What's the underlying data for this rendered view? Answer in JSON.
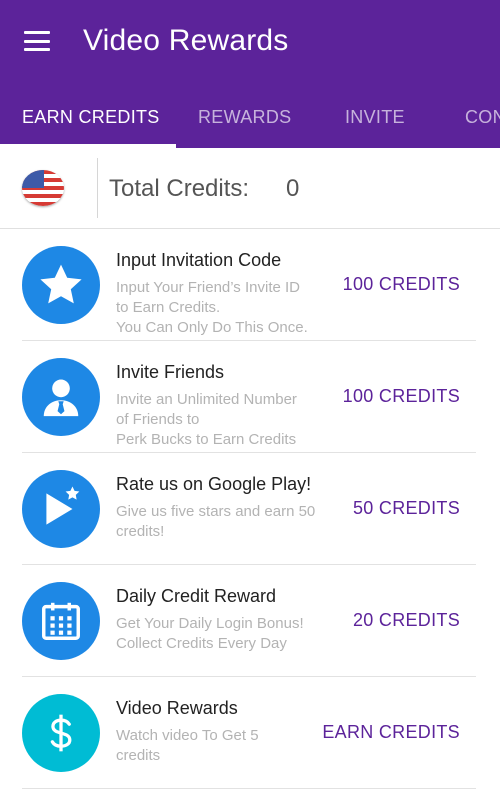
{
  "colors": {
    "primary": "#5c239a",
    "accent_blue": "#1e88e5",
    "accent_cyan": "#00bcd4",
    "action_text": "#5c239a"
  },
  "app": {
    "title": "Video Rewards",
    "menu_icon": "hamburger-menu-icon"
  },
  "tabs": [
    {
      "label": "EARN CREDITS",
      "active": true
    },
    {
      "label": "REWARDS",
      "active": false
    },
    {
      "label": "INVITE",
      "active": false
    },
    {
      "label": "CON",
      "active": false
    }
  ],
  "credits": {
    "flag_icon": "us-flag-icon",
    "label": "Total Credits:",
    "value": "0"
  },
  "offers": [
    {
      "icon": "star-icon",
      "title": "Input Invitation Code",
      "desc_lines": [
        "Input Your Friend’s Invite ID",
        "to Earn Credits.",
        "You Can Only Do This Once."
      ],
      "action": "100 CREDITS"
    },
    {
      "icon": "person-icon",
      "title": "Invite Friends",
      "desc_lines": [
        "Invite an Unlimited Number",
        "of Friends to",
        "Perk Bucks to Earn Credits"
      ],
      "action": "100 CREDITS"
    },
    {
      "icon": "play-star-icon",
      "title": "Rate us on Google Play!",
      "desc_lines": [
        "Give us five stars and earn 50",
        "credits!"
      ],
      "action": "50 CREDITS"
    },
    {
      "icon": "calendar-icon",
      "title": "Daily Credit Reward",
      "desc_lines": [
        "Get Your Daily Login Bonus!",
        "Collect Credits Every Day"
      ],
      "action": "20 CREDITS"
    },
    {
      "icon": "dollar-icon",
      "title": "Video Rewards",
      "desc_lines": [
        "Watch video To Get 5",
        "credits"
      ],
      "action": "EARN CREDITS"
    }
  ]
}
